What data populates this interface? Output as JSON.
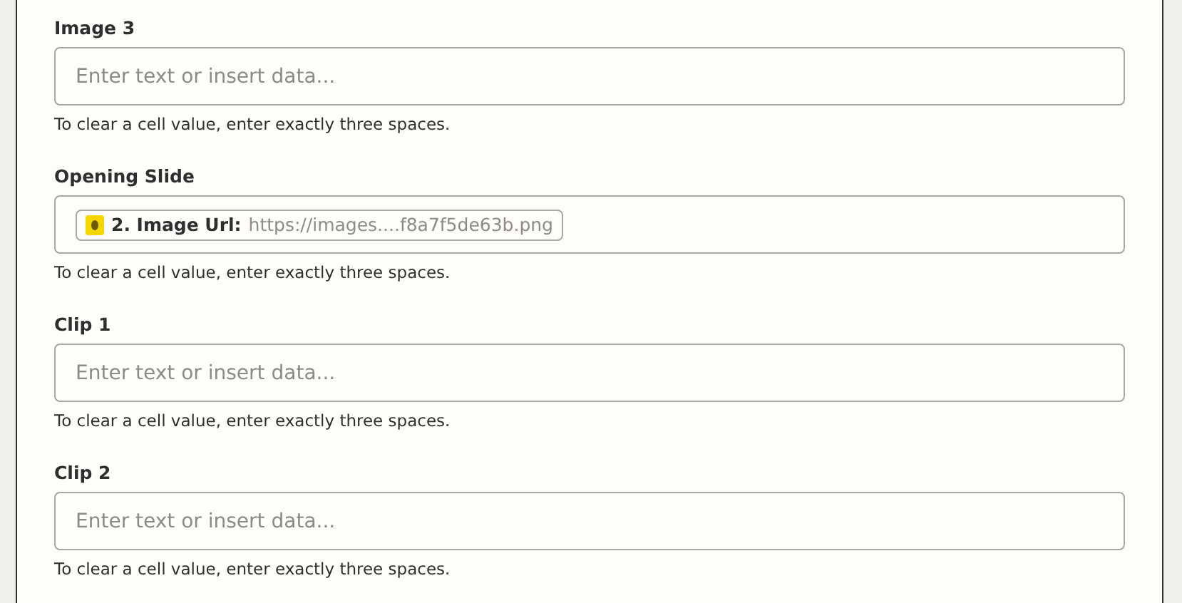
{
  "fields": [
    {
      "label": "Image 3",
      "placeholder": "Enter text or insert data...",
      "help": "To clear a cell value, enter exactly three spaces."
    },
    {
      "label": "Opening Slide",
      "token": {
        "step": "2. Image Url:",
        "value": "https://images....f8a7f5de63b.png"
      },
      "help": "To clear a cell value, enter exactly three spaces."
    },
    {
      "label": "Clip 1",
      "placeholder": "Enter text or insert data...",
      "help": "To clear a cell value, enter exactly three spaces."
    },
    {
      "label": "Clip 2",
      "placeholder": "Enter text or insert data...",
      "help": "To clear a cell value, enter exactly three spaces."
    }
  ]
}
